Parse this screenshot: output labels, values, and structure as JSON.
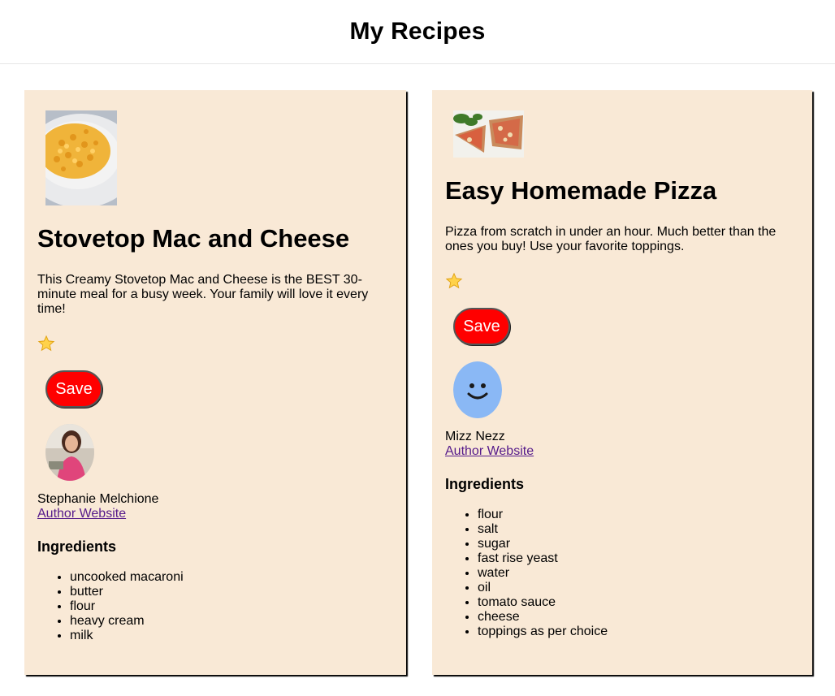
{
  "page": {
    "title": "My Recipes"
  },
  "recipes": [
    {
      "title": "Stovetop Mac and Cheese",
      "description": "This Creamy Stovetop Mac and Cheese is the BEST 30-minute meal for a busy week. Your family will love it every time!",
      "rating_icon": "star-icon",
      "save_label": "Save",
      "author": {
        "name": "Stephanie Melchione",
        "link_label": "Author Website",
        "avatar": "author-photo"
      },
      "image": "mac-and-cheese-photo",
      "ingredients_title": "Ingredients",
      "ingredients": [
        "uncooked macaroni",
        "butter",
        "flour",
        "heavy cream",
        "milk"
      ]
    },
    {
      "title": "Easy Homemade Pizza",
      "description": "Pizza from scratch in under an hour. Much better than the ones you buy! Use your favorite toppings.",
      "rating_icon": "star-icon",
      "save_label": "Save",
      "author": {
        "name": "Mizz Nezz",
        "link_label": "Author Website",
        "avatar": "smiley-avatar-icon"
      },
      "image": "pizza-photo",
      "ingredients_title": "Ingredients",
      "ingredients": [
        "flour",
        "salt",
        "sugar",
        "fast rise yeast",
        "water",
        "oil",
        "tomato sauce",
        "cheese",
        "toppings as per choice"
      ]
    }
  ],
  "colors": {
    "card_bg": "#f9e9d6",
    "save_bg": "#ff0000",
    "link": "#551a8b",
    "avatar_blue": "#8ab8f5",
    "star": "#ffd24a"
  }
}
